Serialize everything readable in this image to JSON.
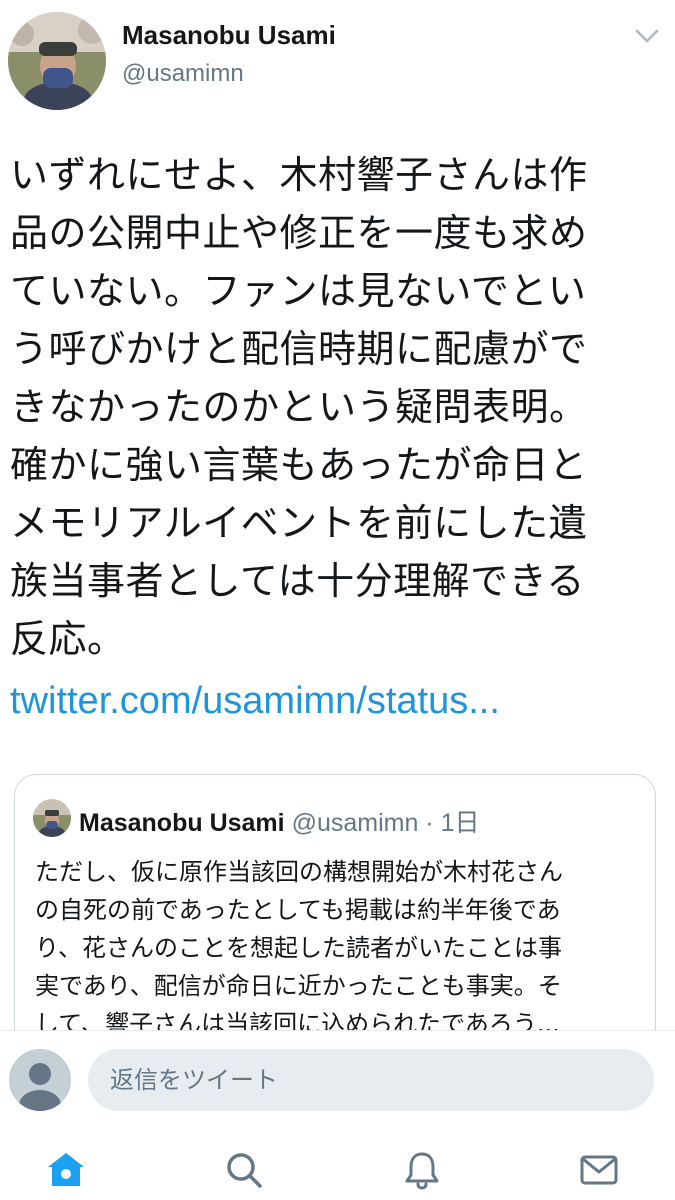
{
  "author": {
    "name": "Masanobu Usami",
    "handle": "@usamimn"
  },
  "tweet": {
    "text": "いずれにせよ、木村響子さんは作\n品の公開中止や修正を一度も求め\nていない。ファンは見ないでとい\nう呼びかけと配信時期に配慮がで\nきなかったのかという疑問表明。\n確かに強い言葉もあったが命日と\nメモリアルイベントを前にした遺\n族当事者としては十分理解できる\n反応。",
    "link": "twitter.com/usamimn/status..."
  },
  "quote": {
    "name": "Masanobu Usami",
    "meta": "@usamimn · 1日",
    "text": "ただし、仮に原作当該回の構想開始が木村花さん\nの自死の前であったとしても掲載は約半年後であ\nり、花さんのことを想起した読者がいたことは事\n実であり、配信が命日に近かったことも事実。そ\nして、響子さんは当該回に込められたであろう..."
  },
  "composer": {
    "placeholder": "返信をツイート"
  },
  "tabs": [
    "home-icon",
    "search-icon",
    "notifications-icon",
    "messages-icon"
  ],
  "colors": {
    "link": "#1b95e0",
    "active_tab": "#1da1f2",
    "inactive_tab": "#657786",
    "muted_text": "#657786"
  }
}
